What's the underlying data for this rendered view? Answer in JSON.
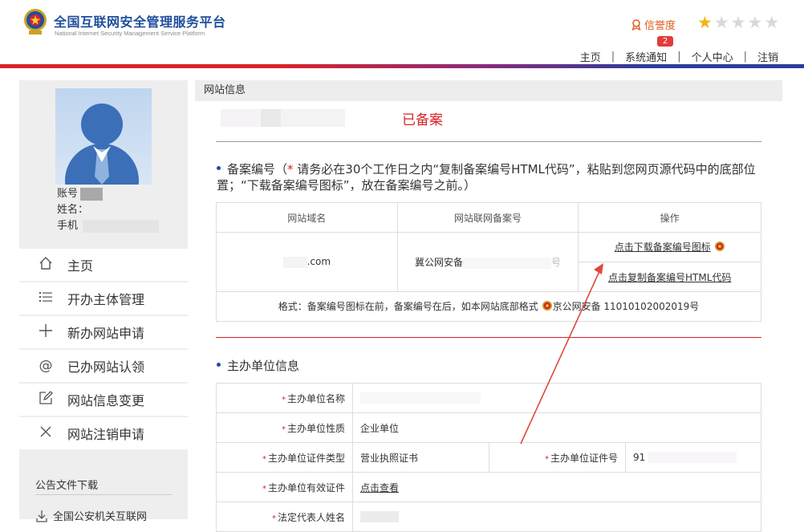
{
  "header": {
    "title": "全国互联网安全管理服务平台",
    "subtitle": "National Internet Security Management Service Platform",
    "credit_label": "信誉度",
    "stars_filled": 1,
    "stars_total": 5,
    "notification_count": "2",
    "nav": [
      "主页",
      "系统通知",
      "个人中心",
      "注销"
    ]
  },
  "sidebar": {
    "account_label": "账号",
    "name_label": "姓名：",
    "phone_label": "手机",
    "menu": [
      {
        "label": "主页",
        "icon": "home-icon"
      },
      {
        "label": "开办主体管理",
        "icon": "list-icon"
      },
      {
        "label": "新办网站申请",
        "icon": "plus-icon"
      },
      {
        "label": "已办网站认领",
        "icon": "at-icon"
      },
      {
        "label": "网站信息变更",
        "icon": "edit-icon"
      },
      {
        "label": "网站注销申请",
        "icon": "close-icon"
      }
    ],
    "notice_title": "公告文件下载",
    "notice_item": "全国公安机关互联网"
  },
  "main": {
    "header": "网站信息",
    "status": "已备案",
    "record_section_title": "备案编号（",
    "record_section_note": "请务必在30个工作日之内“复制备案编号HTML代码”，粘贴到您网页源代码中的底部位置；“下载备案编号图标”，放在备案编号之前。）",
    "table_headers": [
      "网站域名",
      "网站联网备案号",
      "操作"
    ],
    "domain_suffix": ".com",
    "record_number_prefix": "冀公网安备",
    "record_number_suffix": "号",
    "download_icon_link": "点击下载备案编号图标",
    "copy_html_link": "点击复制备案编号HTML代码",
    "format_note_prefix": "格式：备案编号图标在前，备案编号在后，如本网站底部格式",
    "format_note_example": "京公网安备 11010102002019号",
    "org_section_title": "主办单位信息",
    "org_rows": [
      {
        "label": "主办单位名称",
        "value": ""
      },
      {
        "label": "主办单位性质",
        "value": "企业单位"
      },
      {
        "label": "主办单位证件类型",
        "value": "营业执照证书",
        "label2": "主办单位证件号",
        "value2": "91"
      },
      {
        "label": "主办单位有效证件",
        "value": "点击查看"
      },
      {
        "label": "法定代表人姓名",
        "value": ""
      }
    ]
  },
  "colors": {
    "brand_blue": "#1f4e9c",
    "brand_red": "#d8232a",
    "star_gold": "#f2b416",
    "credit_orange": "#e05a1a"
  }
}
